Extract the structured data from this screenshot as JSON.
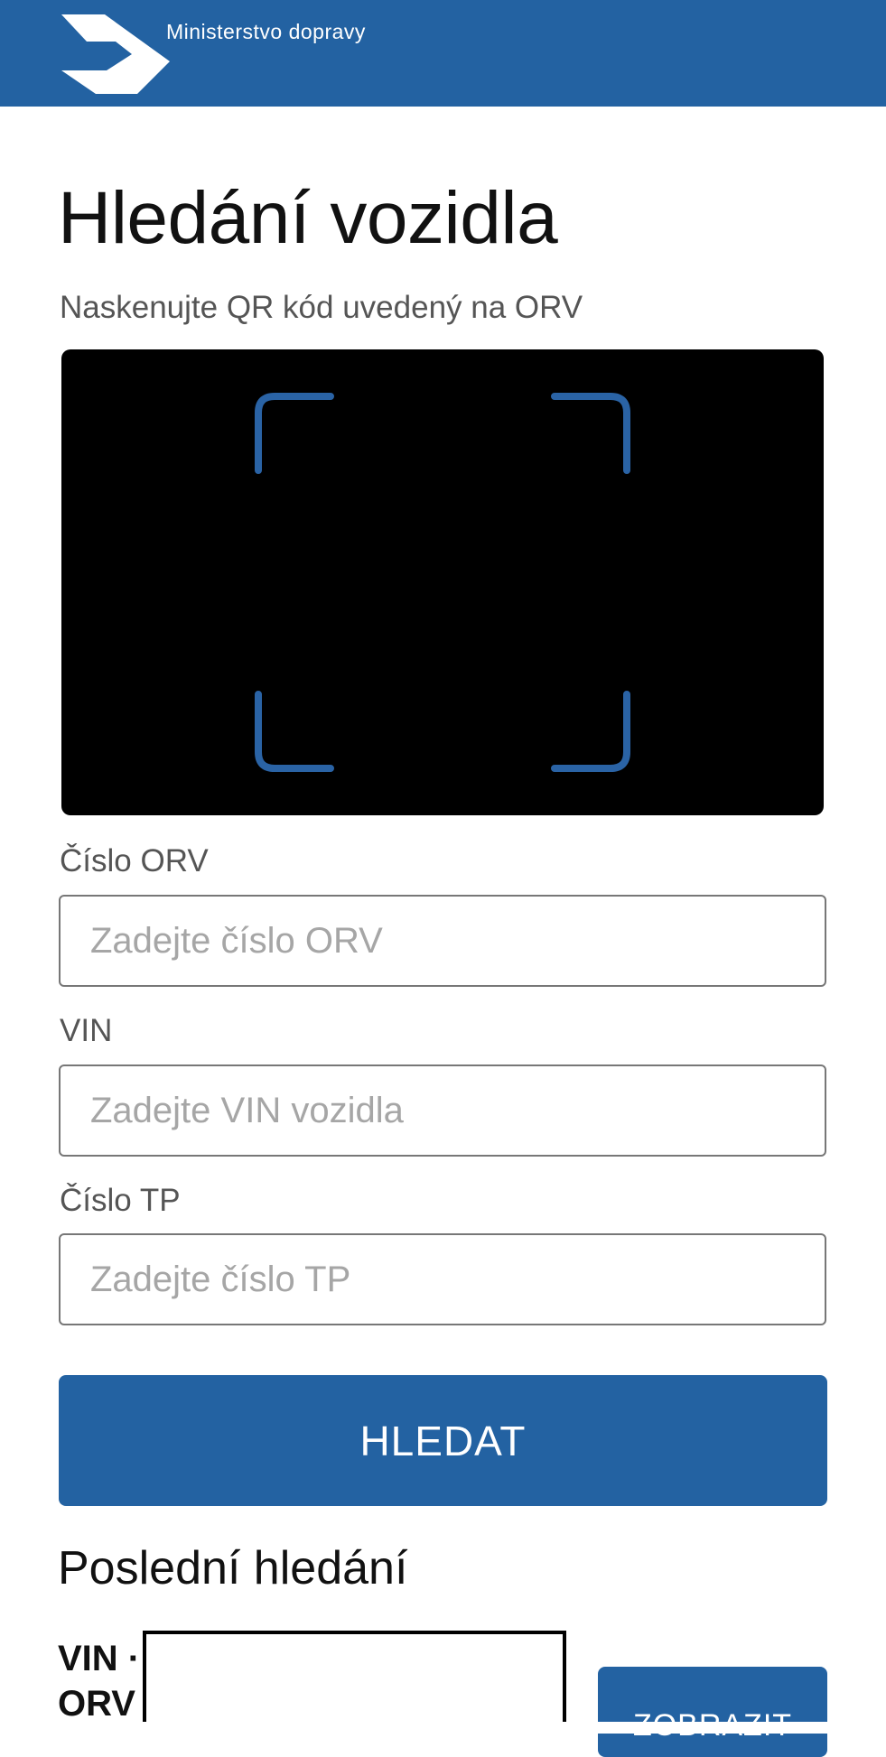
{
  "header": {
    "ministry_name": "Ministerstvo dopravy",
    "logo_icon": "ministry-of-transport-logo",
    "color": "#2362a2"
  },
  "page": {
    "title": "Hledání vozidla",
    "instruction": "Naskenujte QR kód uvedený na ORV"
  },
  "scanner": {
    "frame_icon": "qr-scan-frame",
    "frame_color": "#2a63a5"
  },
  "form": {
    "orv": {
      "label": "Číslo ORV",
      "placeholder": "Zadejte číslo ORV",
      "value": ""
    },
    "vin": {
      "label": "VIN",
      "placeholder": "Zadejte VIN vozidla",
      "value": ""
    },
    "tp": {
      "label": "Číslo TP",
      "placeholder": "Zadejte číslo TP",
      "value": ""
    },
    "search_label": "HLEDAT"
  },
  "recent": {
    "title": "Poslední hledání",
    "items": [
      {
        "label_line1": "VIN ·",
        "label_line2": "ORV",
        "button_label": "ZOBRAZIT"
      }
    ]
  }
}
